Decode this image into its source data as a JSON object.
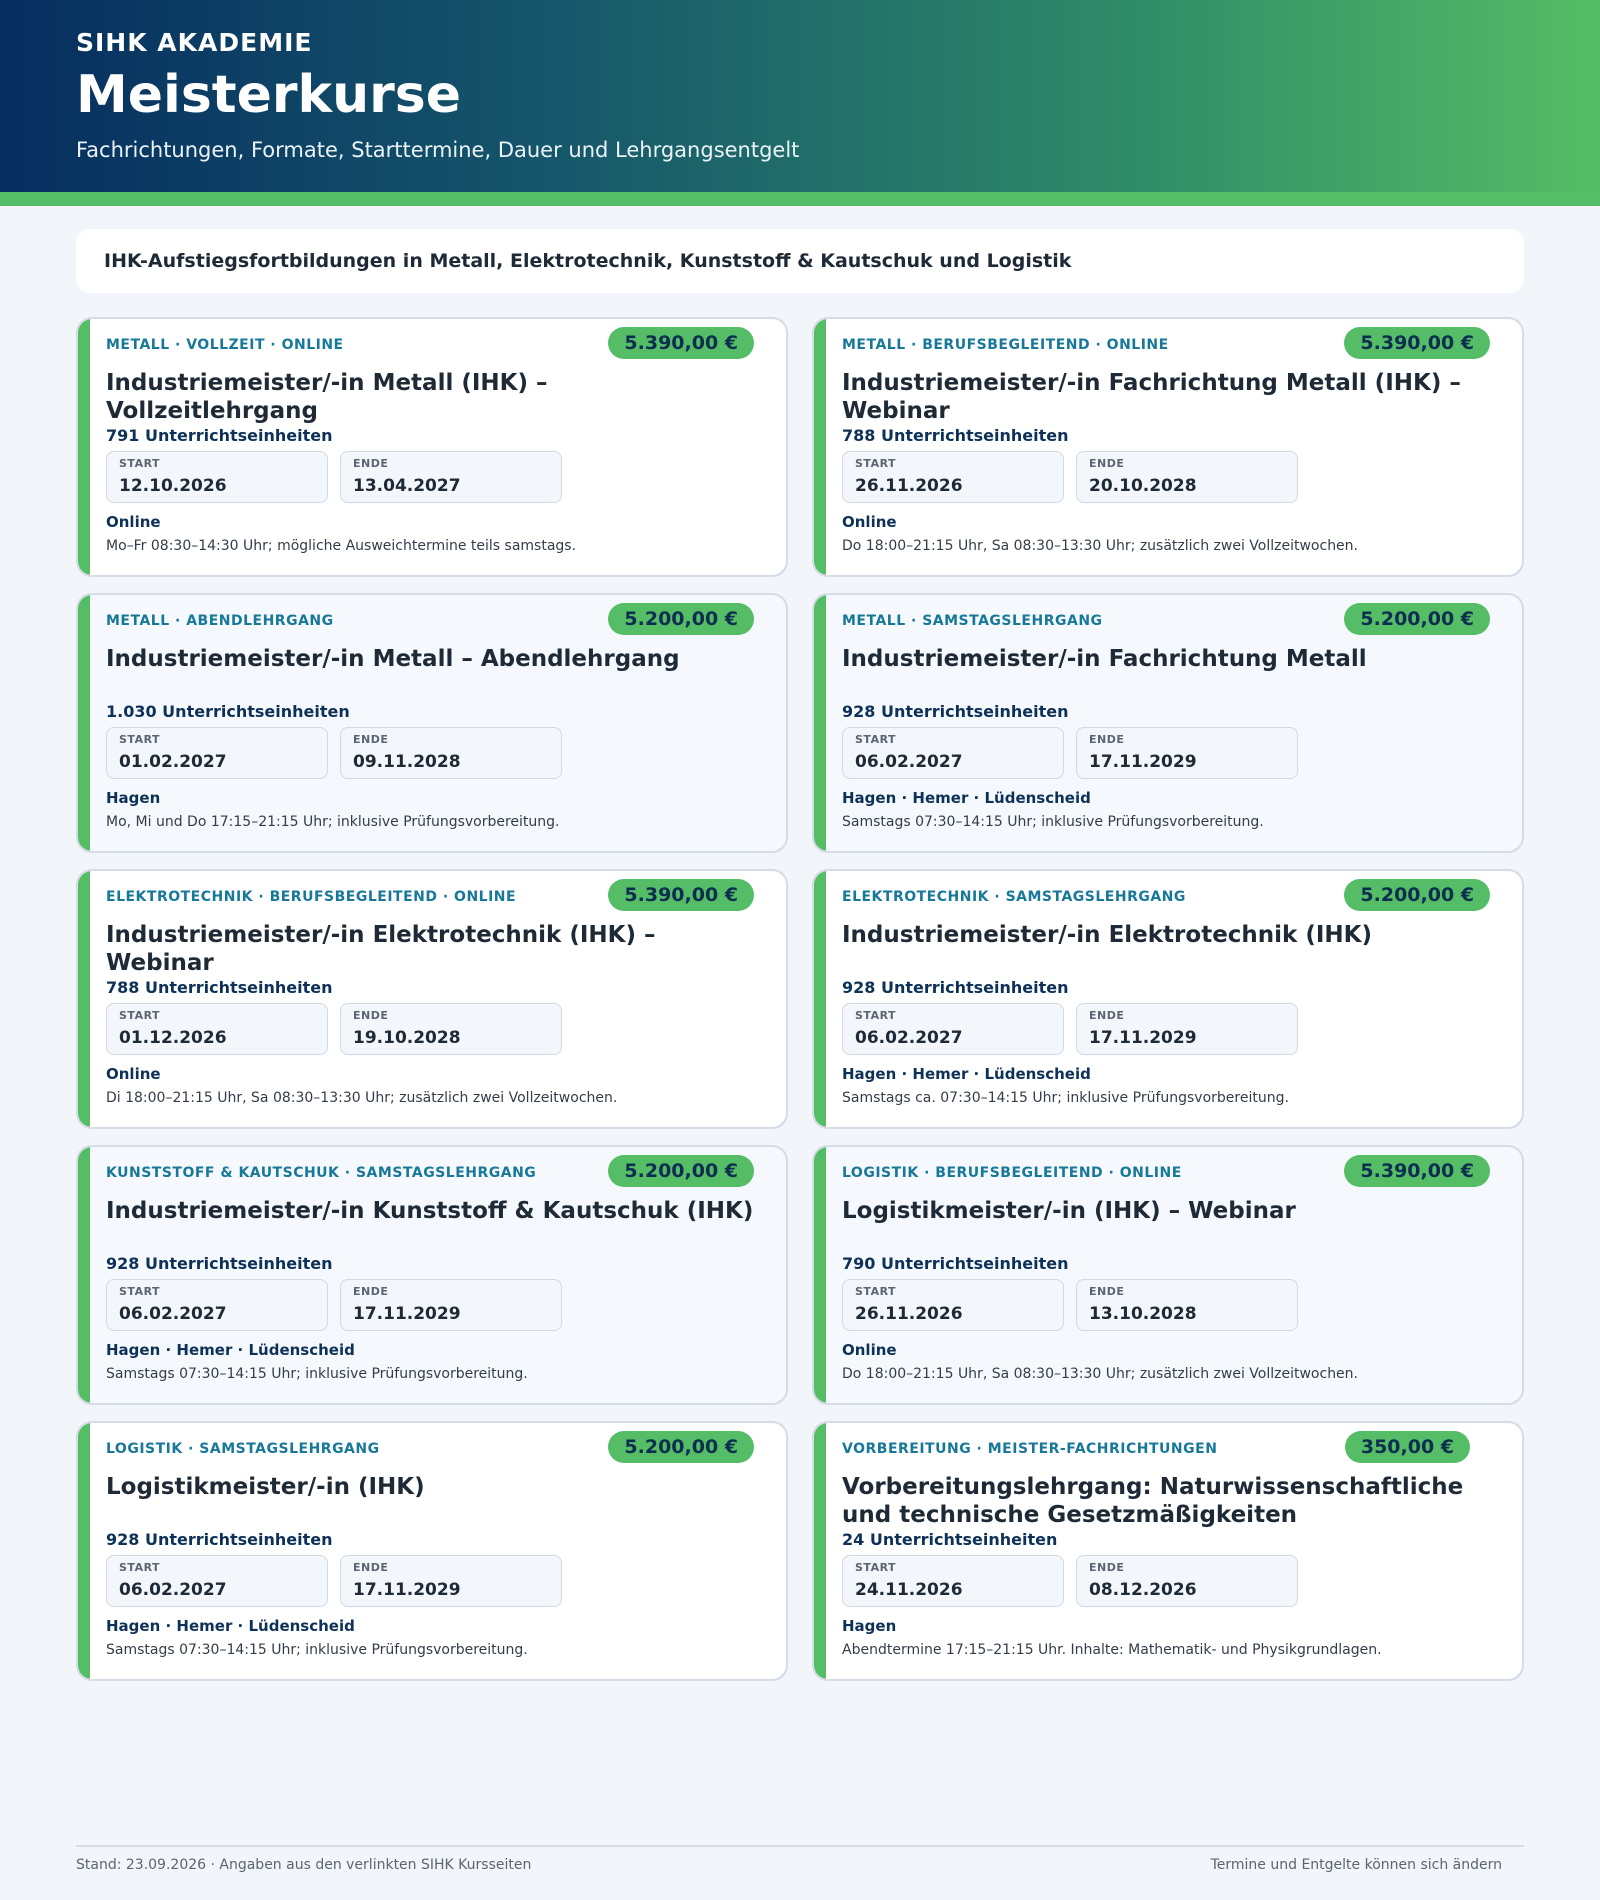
{
  "header": {
    "brand": "SIHK AKADEMIE",
    "title": "Meisterkurse",
    "subtitle": "Fachrichtungen, Formate, Starttermine, Dauer und Lehrgangsentgelt"
  },
  "intro": "IHK-Aufstiegsfortbildungen in Metall, Elektrotechnik, Kunststoff & Kautschuk und Logistik",
  "labels": {
    "start": "START",
    "end": "ENDE"
  },
  "courses": [
    {
      "tag": "METALL · VOLLZEIT · ONLINE",
      "price": "5.390,00 €",
      "title": "Industriemeister/-in Metall (IHK) – Vollzeitlehrgang",
      "units": "791 Unterrichtseinheiten",
      "start": "12.10.2026",
      "end": "13.04.2027",
      "location": "Online",
      "note": "Mo–Fr 08:30–14:30 Uhr; mögliche Ausweichtermine teils samstags."
    },
    {
      "tag": "METALL · BERUFSBEGLEITEND · ONLINE",
      "price": "5.390,00 €",
      "title": "Industriemeister/-in Fachrichtung Metall (IHK) – Webinar",
      "units": "788 Unterrichtseinheiten",
      "start": "26.11.2026",
      "end": "20.10.2028",
      "location": "Online",
      "note": "Do 18:00–21:15 Uhr, Sa 08:30–13:30 Uhr; zusätzlich zwei Vollzeitwochen."
    },
    {
      "tag": "METALL · ABENDLEHRGANG",
      "price": "5.200,00 €",
      "title": "Industriemeister/-in Metall – Abendlehrgang",
      "units": "1.030 Unterrichtseinheiten",
      "start": "01.02.2027",
      "end": "09.11.2028",
      "location": "Hagen",
      "note": "Mo, Mi und Do 17:15–21:15 Uhr; inklusive Prüfungsvorbereitung."
    },
    {
      "tag": "METALL · SAMSTAGSLEHRGANG",
      "price": "5.200,00 €",
      "title": "Industriemeister/-in Fachrichtung Metall",
      "units": "928 Unterrichtseinheiten",
      "start": "06.02.2027",
      "end": "17.11.2029",
      "location": "Hagen · Hemer · Lüdenscheid",
      "note": "Samstags 07:30–14:15 Uhr; inklusive Prüfungsvorbereitung."
    },
    {
      "tag": "ELEKTROTECHNIK · BERUFSBEGLEITEND · ONLINE",
      "price": "5.390,00 €",
      "title": "Industriemeister/-in Elektrotechnik (IHK) – Webinar",
      "units": "788 Unterrichtseinheiten",
      "start": "01.12.2026",
      "end": "19.10.2028",
      "location": "Online",
      "note": "Di 18:00–21:15 Uhr, Sa 08:30–13:30 Uhr; zusätzlich zwei Vollzeitwochen."
    },
    {
      "tag": "ELEKTROTECHNIK · SAMSTAGSLEHRGANG",
      "price": "5.200,00 €",
      "title": "Industriemeister/-in Elektrotechnik (IHK)",
      "units": "928 Unterrichtseinheiten",
      "start": "06.02.2027",
      "end": "17.11.2029",
      "location": "Hagen · Hemer · Lüdenscheid",
      "note": "Samstags ca. 07:30–14:15 Uhr; inklusive Prüfungsvorbereitung."
    },
    {
      "tag": "KUNSTSTOFF & KAUTSCHUK · SAMSTAGSLEHRGANG",
      "price": "5.200,00 €",
      "title": "Industriemeister/-in Kunststoff & Kautschuk (IHK)",
      "units": "928 Unterrichtseinheiten",
      "start": "06.02.2027",
      "end": "17.11.2029",
      "location": "Hagen · Hemer · Lüdenscheid",
      "note": "Samstags 07:30–14:15 Uhr; inklusive Prüfungsvorbereitung."
    },
    {
      "tag": "LOGISTIK · BERUFSBEGLEITEND · ONLINE",
      "price": "5.390,00 €",
      "title": "Logistikmeister/-in (IHK) – Webinar",
      "units": "790 Unterrichtseinheiten",
      "start": "26.11.2026",
      "end": "13.10.2028",
      "location": "Online",
      "note": "Do 18:00–21:15 Uhr, Sa 08:30–13:30 Uhr; zusätzlich zwei Vollzeitwochen."
    },
    {
      "tag": "LOGISTIK · SAMSTAGSLEHRGANG",
      "price": "5.200,00 €",
      "title": "Logistikmeister/-in (IHK)",
      "units": "928 Unterrichtseinheiten",
      "start": "06.02.2027",
      "end": "17.11.2029",
      "location": "Hagen · Hemer · Lüdenscheid",
      "note": "Samstags 07:30–14:15 Uhr; inklusive Prüfungsvorbereitung."
    },
    {
      "tag": "VORBEREITUNG · MEISTER-FACHRICHTUNGEN",
      "price": "350,00 €",
      "title": "Vorbereitungslehrgang: Naturwissenschaftliche und technische Gesetzmäßigkeiten",
      "units": "24 Unterrichtseinheiten",
      "start": "24.11.2026",
      "end": "08.12.2026",
      "location": "Hagen",
      "note": "Abendtermine 17:15–21:15 Uhr. Inhalte: Mathematik- und Physikgrundlagen."
    }
  ],
  "footer": {
    "left": "Stand: 23.09.2026 · Angaben aus den verlinkten SIHK Kursseiten",
    "right": "Termine und Entgelte können sich ändern"
  }
}
